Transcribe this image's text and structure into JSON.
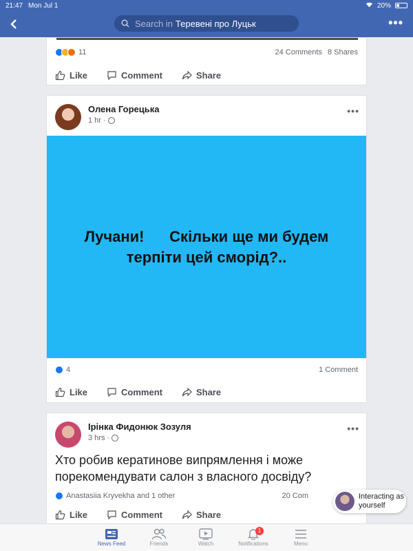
{
  "status_bar": {
    "time": "21:47",
    "date": "Mon Jul 1",
    "battery": "20%"
  },
  "header": {
    "search_prefix": "Search in",
    "search_group": "Теревені про Луцьк"
  },
  "post1": {
    "reaction_count": "11",
    "comments": "24 Comments",
    "shares": "8 Shares"
  },
  "actions": {
    "like": "Like",
    "comment": "Comment",
    "share": "Share"
  },
  "post2": {
    "author": "Олена Горецька",
    "time": "1 hr",
    "image_text_line1": "Лучани!      Скільки ще ми будем",
    "image_text_line2": "терпіти цей сморід?..",
    "reaction_count": "4",
    "comments": "1 Comment"
  },
  "post3": {
    "author": "Ірінка Фидонюк Зозуля",
    "time": "3 hrs",
    "text": "Хто робив кератинове випрямлення і може порекомендувати салон з власного досвіду?",
    "likers": "Anastasiia Kryvekha and 1 other",
    "comments": "20 Com"
  },
  "toast": {
    "text": "Interacting as yourself"
  },
  "tabs": [
    {
      "label": "News Feed"
    },
    {
      "label": "Friends"
    },
    {
      "label": "Watch"
    },
    {
      "label": "Notifications",
      "badge": "1"
    },
    {
      "label": "Menu"
    }
  ],
  "colors": {
    "brand": "#4267b2",
    "meme_bg": "#22b8f6",
    "badge": "#fa3e3e"
  }
}
